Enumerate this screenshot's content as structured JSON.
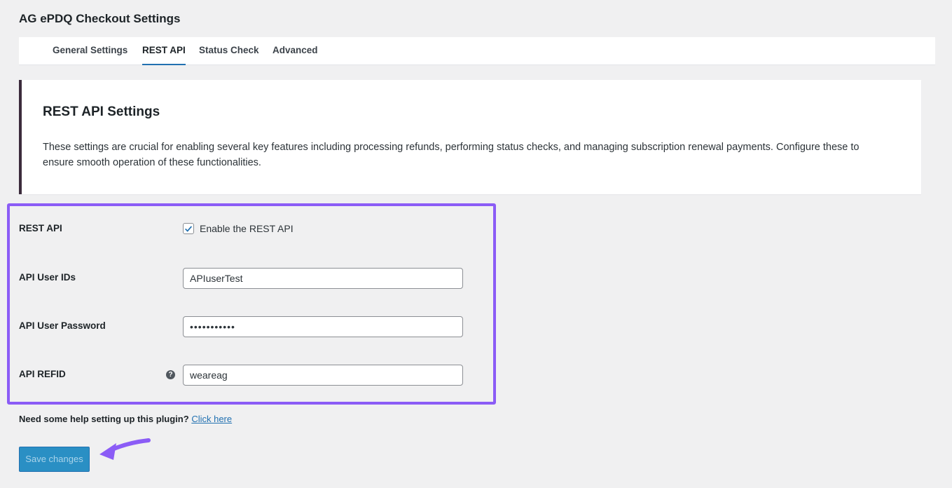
{
  "page": {
    "title": "AG ePDQ Checkout Settings"
  },
  "tabs": [
    {
      "label": "General Settings",
      "active": false
    },
    {
      "label": "REST API",
      "active": true
    },
    {
      "label": "Status Check",
      "active": false
    },
    {
      "label": "Advanced",
      "active": false
    }
  ],
  "intro": {
    "title": "REST API Settings",
    "text": "These settings are crucial for enabling several key features including processing refunds, performing status checks, and managing subscription renewal payments. Configure these to ensure smooth operation of these functionalities."
  },
  "form": {
    "rest_api": {
      "label": "REST API",
      "checkbox_label": "Enable the REST API",
      "checked": true
    },
    "api_user_ids": {
      "label": "API User IDs",
      "value": "APIuserTest"
    },
    "api_user_password": {
      "label": "API User Password",
      "value": "•••••••••••"
    },
    "api_refid": {
      "label": "API REFID",
      "value": "weareag",
      "help_icon": "question-circle-icon"
    }
  },
  "help": {
    "text": "Need some help setting up this plugin?",
    "link_text": "Click here"
  },
  "actions": {
    "save_label": "Save changes"
  },
  "colors": {
    "highlight": "#8b5cf6",
    "primary": "#2271b1",
    "card_accent": "#3b2b3c"
  }
}
